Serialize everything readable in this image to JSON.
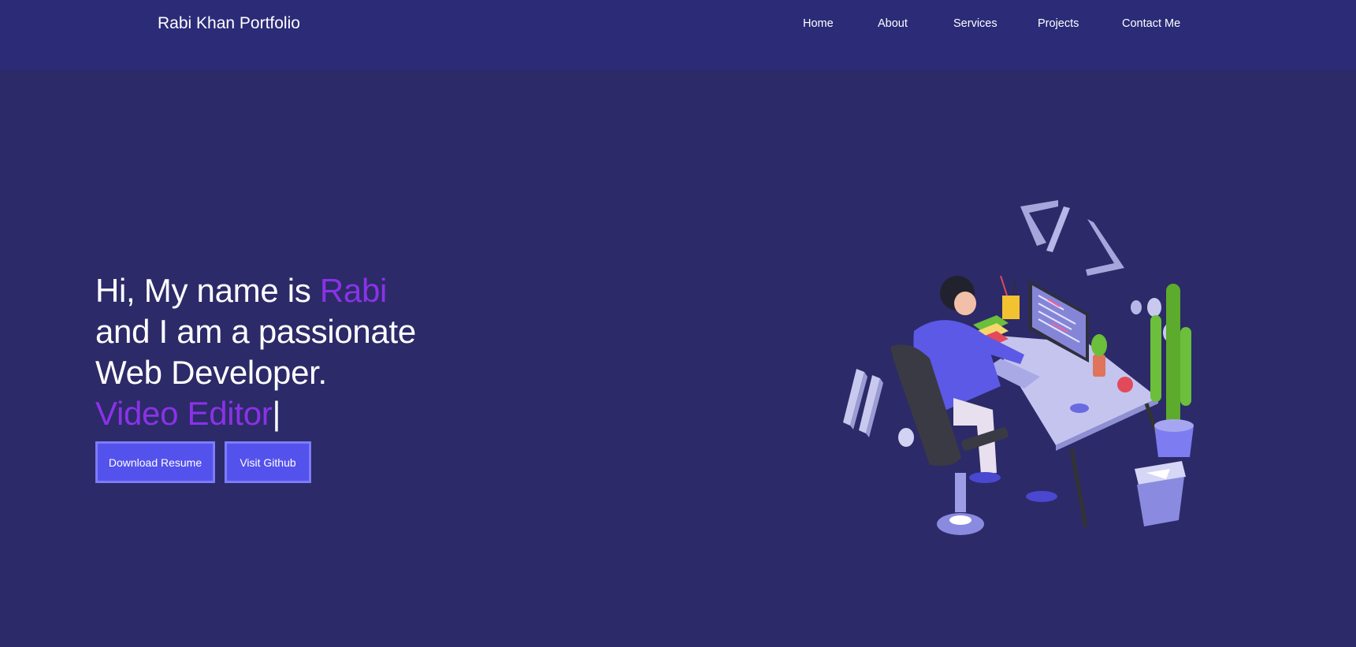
{
  "navbar": {
    "brand": "Rabi Khan Portfolio",
    "links": [
      "Home",
      "About",
      "Services",
      "Projects",
      "Contact Me"
    ]
  },
  "hero": {
    "line1_prefix": "Hi, My name is ",
    "line1_name": "Rabi",
    "line2": "and I am a passionate",
    "line3": "Web Developer.",
    "typed_text": "Video Editor",
    "cursor": "|"
  },
  "buttons": {
    "download_resume": "Download Resume",
    "visit_github": "Visit Github"
  },
  "colors": {
    "background": "#2c2a68",
    "navbar": "#2b2b78",
    "accent": "#8a32e8",
    "button": "#5452ec",
    "button_border": "#7d7cf8"
  },
  "illustration": {
    "icons": [
      "code-brackets-icon",
      "developer-at-desk-illustration",
      "cactus-plant-icon",
      "trash-bin-icon"
    ]
  }
}
